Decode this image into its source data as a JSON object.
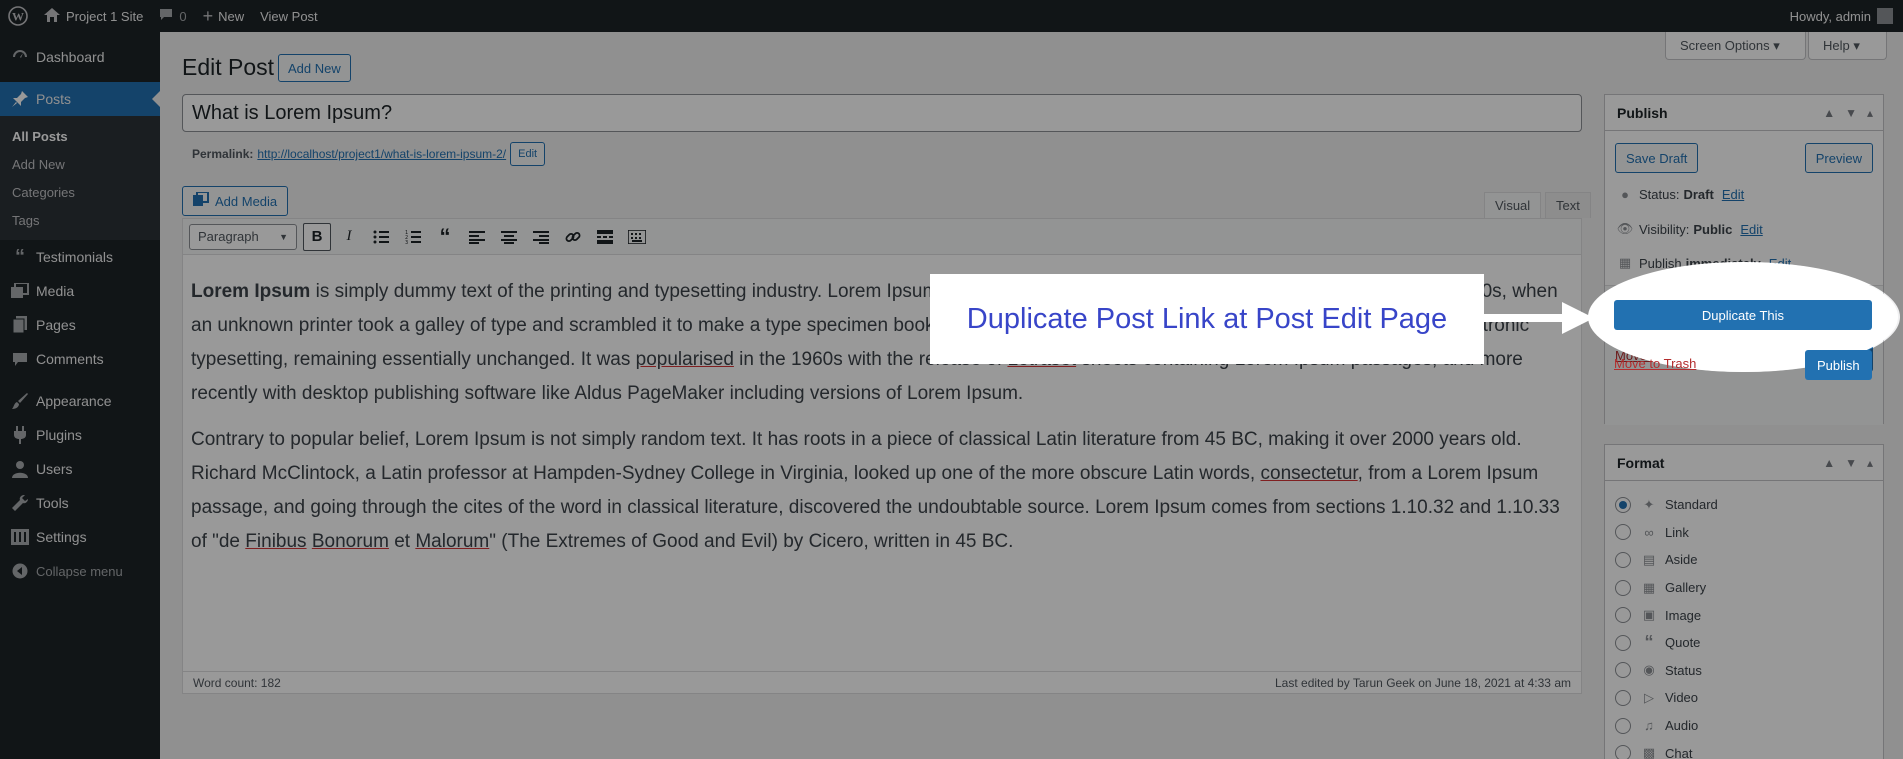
{
  "adminbar": {
    "site_name": "Project 1 Site",
    "comments_count": "0",
    "new_label": "New",
    "view_post_label": "View Post",
    "greeting": "Howdy, admin"
  },
  "sidebar": {
    "items": [
      {
        "label": "Dashboard",
        "icon": "dashboard-icon"
      },
      {
        "label": "Posts",
        "icon": "pin-icon",
        "active": true
      },
      {
        "label": "Testimonials",
        "icon": "quote-icon"
      },
      {
        "label": "Media",
        "icon": "media-icon"
      },
      {
        "label": "Pages",
        "icon": "pages-icon"
      },
      {
        "label": "Comments",
        "icon": "comments-icon"
      },
      {
        "label": "Appearance",
        "icon": "brush-icon"
      },
      {
        "label": "Plugins",
        "icon": "plugin-icon"
      },
      {
        "label": "Users",
        "icon": "user-icon"
      },
      {
        "label": "Tools",
        "icon": "wrench-icon"
      },
      {
        "label": "Settings",
        "icon": "settings-icon"
      }
    ],
    "submenu": [
      "All Posts",
      "Add New",
      "Categories",
      "Tags"
    ],
    "collapse_label": "Collapse menu"
  },
  "header": {
    "screen_options": "Screen Options ▾",
    "help": "Help ▾",
    "title": "Edit Post",
    "add_new": "Add New"
  },
  "post": {
    "title": "What is Lorem Ipsum?",
    "permalink_label": "Permalink:",
    "permalink_url": "http://localhost/project1/what-is-lorem-ipsum-2/",
    "permalink_edit": "Edit"
  },
  "editor": {
    "add_media": "Add Media",
    "tab_visual": "Visual",
    "tab_text": "Text",
    "format_select": "Paragraph",
    "para1_bold": "Lorem Ipsum",
    "para1_a": " is simply dummy text of the printing and typesetting industry. Lorem Ipsum has been the industry's standard dummy text ever since the 1500s, when an unknown printer took a galley of type and scrambled it to make a type specimen book. It has survived not only five centuries, but also the leap into electronic typesetting, remaining essentially unchanged. It was ",
    "para1_w1": "popularised",
    "para1_b": " in the 1960s with the release of ",
    "para1_w2": "Letraset",
    "para1_c": " sheets containing Lorem Ipsum passages, and more recently with desktop publishing software like Aldus PageMaker including versions of Lorem Ipsum.",
    "para2_a": "Contrary to popular belief, Lorem Ipsum is not simply random text. It has roots in a piece of classical Latin literature from 45 BC, making it over 2000 years old. Richard McClintock, a Latin professor at Hampden-Sydney College in Virginia, looked up one of the more obscure Latin words, ",
    "para2_w1": "consectetur",
    "para2_b": ", from a Lorem Ipsum passage, and going through the cites of the word in classical literature, discovered the undoubtable source. Lorem Ipsum comes from sections 1.10.32 and 1.10.33 of \"de ",
    "para2_w2": "Finibus",
    "para2_sp1": " ",
    "para2_w3": "Bonorum",
    "para2_c": " et ",
    "para2_w4": "Malorum",
    "para2_d": "\" (The Extremes of Good and Evil) by Cicero, written in 45 BC.",
    "word_count": "Word count: 182",
    "last_edited": "Last edited by Tarun Geek on June 18, 2021 at 4:33 am"
  },
  "publish": {
    "title": "Publish",
    "save_draft": "Save Draft",
    "preview": "Preview",
    "status_label": "Status:",
    "status_value": "Draft",
    "visibility_label": "Visibility:",
    "visibility_value": "Public",
    "schedule_label": "Publish",
    "schedule_value": "immediately",
    "edit": "Edit",
    "duplicate": "Duplicate This",
    "trash": "Move to Trash",
    "publish_btn": "Publish"
  },
  "format": {
    "title": "Format",
    "options": [
      {
        "label": "Standard",
        "icon": "pin-icon",
        "checked": true
      },
      {
        "label": "Link",
        "icon": "link-icon"
      },
      {
        "label": "Aside",
        "icon": "aside-icon"
      },
      {
        "label": "Gallery",
        "icon": "gallery-icon"
      },
      {
        "label": "Image",
        "icon": "image-icon"
      },
      {
        "label": "Quote",
        "icon": "quote-icon"
      },
      {
        "label": "Status",
        "icon": "status-icon"
      },
      {
        "label": "Video",
        "icon": "video-icon"
      },
      {
        "label": "Audio",
        "icon": "audio-icon"
      },
      {
        "label": "Chat",
        "icon": "chat-icon"
      }
    ]
  },
  "annotation": {
    "callout": "Duplicate Post Link at Post Edit Page"
  },
  "colors": {
    "accent": "#2271b1",
    "adminbar": "#1d2327",
    "callout_text": "#3845c8",
    "overlay": "rgba(0,0,0,0.4)"
  }
}
